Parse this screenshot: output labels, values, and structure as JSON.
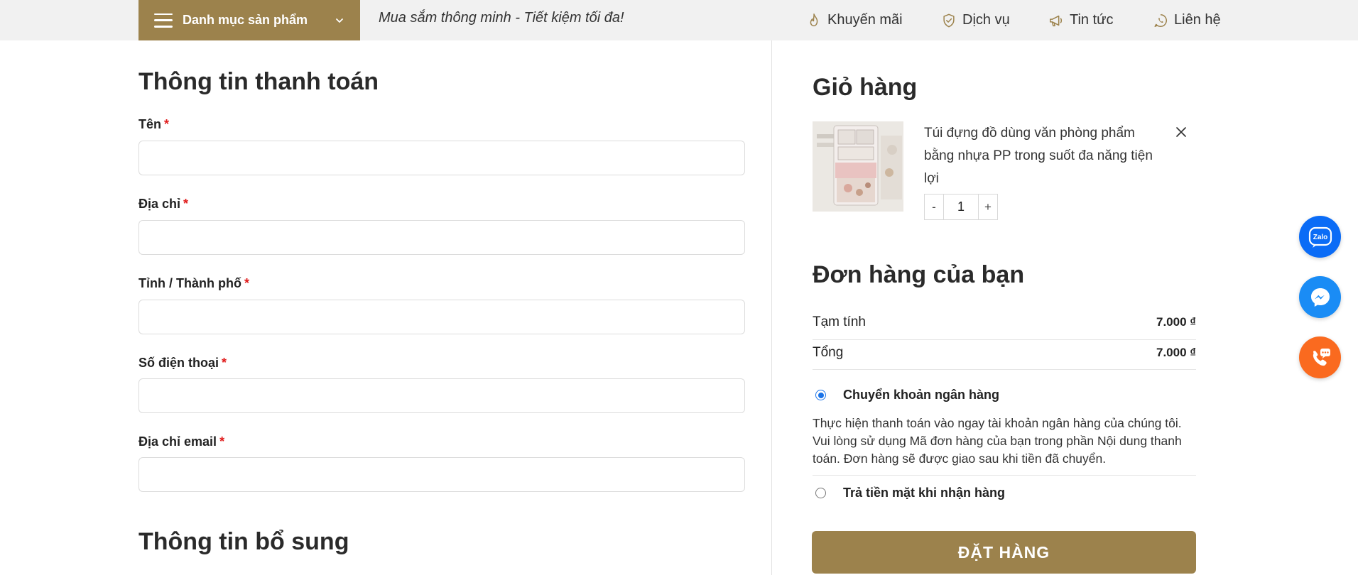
{
  "topbar": {
    "category_label": "Danh mục sản phẩm",
    "slogan": "Mua sắm thông minh - Tiết kiệm tối đa!",
    "nav": [
      {
        "label": "Khuyến mãi",
        "icon": "fire-icon"
      },
      {
        "label": "Dịch vụ",
        "icon": "shield-check-icon"
      },
      {
        "label": "Tin tức",
        "icon": "megaphone-icon"
      },
      {
        "label": "Liên hệ",
        "icon": "whatsapp-icon"
      }
    ]
  },
  "billing": {
    "title": "Thông tin thanh toán",
    "required_mark": "*",
    "fields": [
      {
        "label": "Tên",
        "value": ""
      },
      {
        "label": "Địa chỉ",
        "value": ""
      },
      {
        "label": "Tỉnh / Thành phố",
        "value": ""
      },
      {
        "label": "Số điện thoại",
        "value": ""
      },
      {
        "label": "Địa chỉ email",
        "value": ""
      }
    ],
    "extra_title": "Thông tin bổ sung"
  },
  "cart": {
    "title": "Giỏ hàng",
    "item": {
      "name": "Túi đựng đồ dùng văn phòng phẩm bằng nhựa PP trong suốt đa năng tiện lợi",
      "qty_minus": "-",
      "qty": "1",
      "qty_plus": "+"
    }
  },
  "order": {
    "title": "Đơn hàng của bạn",
    "subtotal_label": "Tạm tính",
    "subtotal_value": "7.000 ₫",
    "total_label": "Tổng",
    "total_value": "7.000 ₫",
    "payments": [
      {
        "label": "Chuyển khoản ngân hàng",
        "selected": true
      },
      {
        "label": "Trả tiền mặt khi nhận hàng",
        "selected": false
      }
    ],
    "bank_desc": "Thực hiện thanh toán vào ngay tài khoản ngân hàng của chúng tôi. Vui lòng sử dụng Mã đơn hàng của bạn trong phần Nội dung thanh toán. Đơn hàng sẽ được giao sau khi tiền đã chuyển.",
    "place_order": "ĐẶT HÀNG"
  },
  "floating": {
    "zalo_label": "Zalo"
  },
  "colors": {
    "brand": "#9c824c",
    "topbar_bg": "#f1f1f1",
    "required": "#e01b1b",
    "radio_on": "#1a73e8",
    "zalo": "#0b6cf6",
    "messenger": "#1a8cf5",
    "phone": "#fa6a1f"
  }
}
